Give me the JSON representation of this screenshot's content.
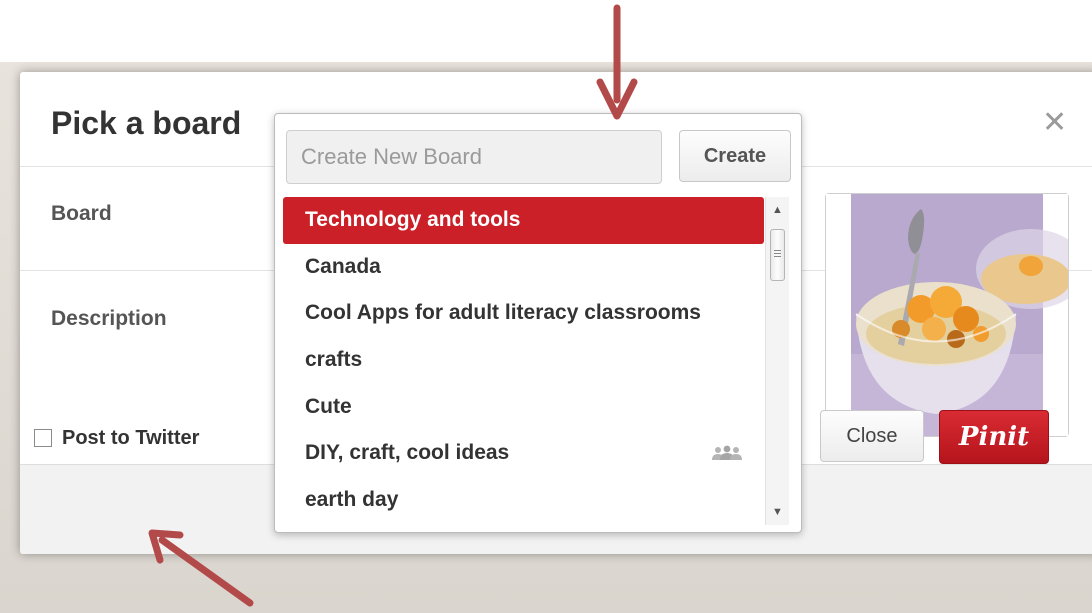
{
  "dialog": {
    "title": "Pick a board",
    "close_icon": "close-icon",
    "board_label": "Board",
    "description_label": "Description"
  },
  "dropdown": {
    "new_board_placeholder": "Create New Board",
    "create_label": "Create",
    "boards": [
      {
        "label": "Technology and tools",
        "selected": true
      },
      {
        "label": "Canada"
      },
      {
        "label": "Cool Apps for adult literacy classrooms"
      },
      {
        "label": "crafts"
      },
      {
        "label": "Cute"
      },
      {
        "label": "DIY, craft, cool ideas",
        "icon": "group-board-icon"
      },
      {
        "label": "earth day"
      }
    ]
  },
  "footer": {
    "post_to_twitter_label": "Post to Twitter",
    "close_label": "Close",
    "pinit_label": "Pinit"
  },
  "colors": {
    "accent_red": "#cb2027",
    "annotation_arrow": "#b34a4a"
  }
}
